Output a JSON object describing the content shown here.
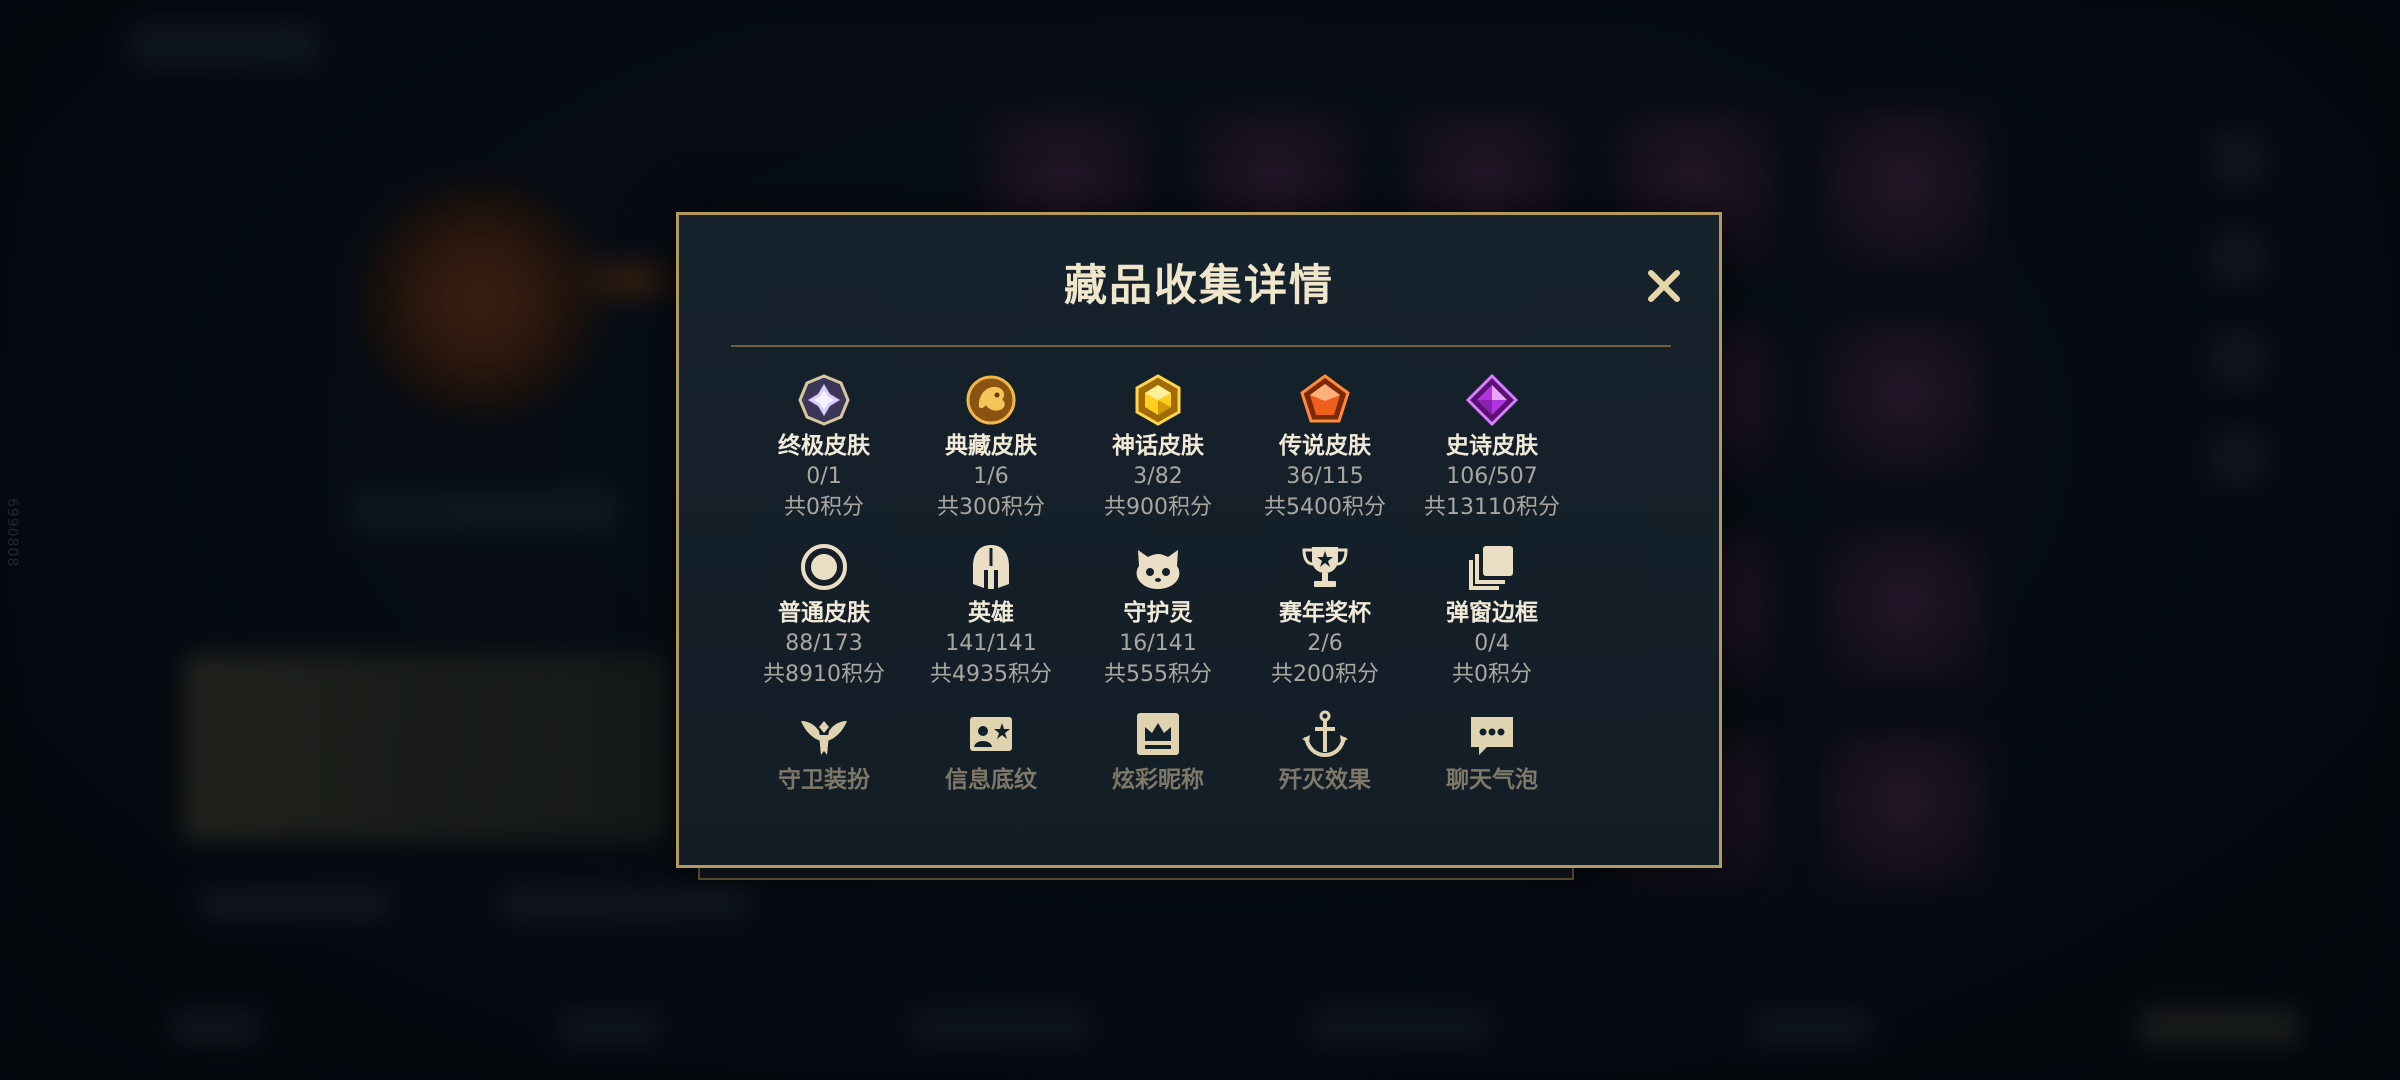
{
  "background": {
    "side_text": "6990808"
  },
  "dialog": {
    "title": "藏品收集详情",
    "close_icon": "close-icon",
    "categories": [
      {
        "name": "终极皮肤",
        "count": "0/1",
        "score": "共0积分",
        "icon": "ultimate-skin-icon",
        "color": "#c9b6ff"
      },
      {
        "name": "典藏皮肤",
        "count": "1/6",
        "score": "共300积分",
        "icon": "collector-skin-icon",
        "color": "#e0a23a"
      },
      {
        "name": "神话皮肤",
        "count": "3/82",
        "score": "共900积分",
        "icon": "mythic-skin-icon",
        "color": "#f2c21b"
      },
      {
        "name": "传说皮肤",
        "count": "36/115",
        "score": "共5400积分",
        "icon": "legendary-skin-icon",
        "color": "#f06a1e"
      },
      {
        "name": "史诗皮肤",
        "count": "106/507",
        "score": "共13110积分",
        "icon": "epic-skin-icon",
        "color": "#b233e0"
      },
      {
        "name": "普通皮肤",
        "count": "88/173",
        "score": "共8910积分",
        "icon": "normal-skin-icon",
        "color": "#e8dcc0"
      },
      {
        "name": "英雄",
        "count": "141/141",
        "score": "共4935积分",
        "icon": "hero-helmet-icon",
        "color": "#e8dcc0"
      },
      {
        "name": "守护灵",
        "count": "16/141",
        "score": "共555积分",
        "icon": "guardian-spirit-icon",
        "color": "#e8dcc0"
      },
      {
        "name": "赛年奖杯",
        "count": "2/6",
        "score": "共200积分",
        "icon": "trophy-icon",
        "color": "#e8dcc0"
      },
      {
        "name": "弹窗边框",
        "count": "0/4",
        "score": "共0积分",
        "icon": "popup-frame-icon",
        "color": "#e8dcc0"
      },
      {
        "name": "守卫装扮",
        "icon": "guard-outfit-icon",
        "color": "#e0d3b0"
      },
      {
        "name": "信息底纹",
        "icon": "info-background-icon",
        "color": "#e0d3b0"
      },
      {
        "name": "炫彩昵称",
        "icon": "colorful-nickname-icon",
        "color": "#e0d3b0"
      },
      {
        "name": "歼灭效果",
        "icon": "elimination-effect-icon",
        "color": "#e0d3b0"
      },
      {
        "name": "聊天气泡",
        "icon": "chat-bubble-icon",
        "color": "#e0d3b0"
      }
    ]
  }
}
